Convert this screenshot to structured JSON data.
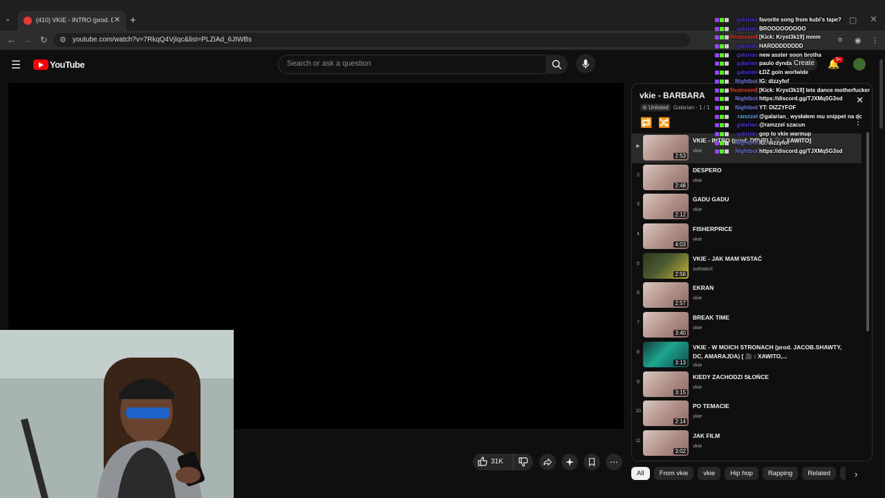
{
  "browser": {
    "tab_title": "(410) VKIE - INTRO (prod. DRVR...",
    "url": "youtube.com/watch?v=7RkqQ4VjIqc&list=PLZiAd_6JIWBs"
  },
  "youtube": {
    "logo_text": "YouTube",
    "search_placeholder": "Search or ask a question",
    "create_label": "Create",
    "notif_count": "9+"
  },
  "actions": {
    "like_count": "31K"
  },
  "playlist": {
    "title": "vkie - BARBARA",
    "visibility": "Unlisted",
    "meta": "Galarian - 1 / 1",
    "items": [
      {
        "index": "",
        "title": "VKIE - INTRO (prod. DRVR) [ 🎥 : XAWITO]",
        "channel": "vkie",
        "duration": "2:53"
      },
      {
        "index": "2",
        "title": "DESPERO",
        "channel": "vkie",
        "duration": "2:48"
      },
      {
        "index": "3",
        "title": "GADU GADU",
        "channel": "vkie",
        "duration": "2:12"
      },
      {
        "index": "4",
        "title": "FISHERPRICE",
        "channel": "vkie",
        "duration": "4:03"
      },
      {
        "index": "5",
        "title": "VKIE - JAK MAM WSTAĆ",
        "channel": "sothatsX",
        "duration": "2:56"
      },
      {
        "index": "6",
        "title": "EKRAN",
        "channel": "vkie",
        "duration": "2:57"
      },
      {
        "index": "7",
        "title": "BREAK TIME",
        "channel": "vkie",
        "duration": "3:40"
      },
      {
        "index": "8",
        "title": "VKIE - W MOICH STRONACH (prod. JACOB.SHAWTY, DC, AMARAJDA) [ 🎥 : XAWITO,...",
        "channel": "vkie",
        "duration": "3:13"
      },
      {
        "index": "9",
        "title": "KIEDY ZACHODZI SŁOŃCE",
        "channel": "vkie",
        "duration": "3:15"
      },
      {
        "index": "10",
        "title": "PO TEMACIE",
        "channel": "vkie",
        "duration": "2:14"
      },
      {
        "index": "11",
        "title": "JAK FILM",
        "channel": "vkie",
        "duration": "3:02"
      }
    ]
  },
  "chips": [
    "All",
    "From vkie",
    "vkie",
    "Hip hop",
    "Rapping",
    "Related",
    "Fo"
  ],
  "chat": [
    {
      "user": "galarian",
      "color": "#4a3bd6",
      "msg": "favorite song from kubi's tape?"
    },
    {
      "user": "galarian",
      "color": "#4a3bd6",
      "msg": "BROOOOOOOOO"
    },
    {
      "user": "RestreamBot",
      "color": "#e0452a",
      "msg": "[Kick: Kryst3k19] mmm"
    },
    {
      "user": "galarian",
      "color": "#4a3bd6",
      "msg": "HARDDDDDDDD"
    },
    {
      "user": "galarian",
      "color": "#4a3bd6",
      "msg": "new asster soon brotha"
    },
    {
      "user": "galarian",
      "color": "#4a3bd6",
      "msg": "paulo dynda"
    },
    {
      "user": "galarian",
      "color": "#4a3bd6",
      "msg": "ŁDZ goin worlwide"
    },
    {
      "user": "Nightbot",
      "color": "#6f7de0",
      "msg": "IG: dizzyfof"
    },
    {
      "user": "RestreamBot",
      "color": "#e0452a",
      "msg": "[Kick: Kryst3k19] lets dance motherfucker"
    },
    {
      "user": "Nightbot",
      "color": "#6f7de0",
      "msg": "https://discord.gg/TJXMq5G3sd"
    },
    {
      "user": "Nightbot",
      "color": "#6f7de0",
      "msg": "YT: DIZZYFOF"
    },
    {
      "user": "ramzzel",
      "color": "#5aa9e6",
      "msg": "@galarian_ wysłałem mu snippet na dc"
    },
    {
      "user": "galarian",
      "color": "#4a3bd6",
      "msg": "@ramzzel szacun"
    },
    {
      "user": "galarian",
      "color": "#4a3bd6",
      "msg": "gop to vkie warmup"
    },
    {
      "user": "Nightbot",
      "color": "#6f7de0",
      "msg": "IG: dizzyfof"
    },
    {
      "user": "Nightbot",
      "color": "#6f7de0",
      "msg": "https://discord.gg/TJXMq5G3sd"
    }
  ]
}
